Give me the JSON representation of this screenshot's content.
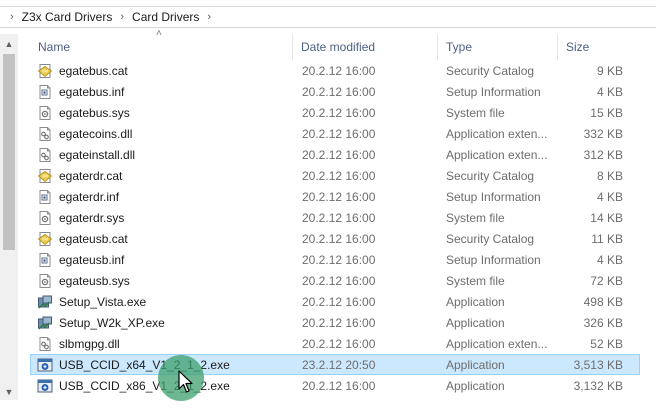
{
  "breadcrumb": {
    "items": [
      {
        "label": "Z3x Card Drivers"
      },
      {
        "label": "Card Drivers"
      }
    ]
  },
  "header": {
    "name": "Name",
    "date": "Date modified",
    "type": "Type",
    "size": "Size"
  },
  "files": [
    {
      "name": "egatebus.cat",
      "date": "20.2.12 16:00",
      "type": "Security Catalog",
      "size": "9 KB",
      "icon": "catalog-icon"
    },
    {
      "name": "egatebus.inf",
      "date": "20.2.12 16:00",
      "type": "Setup Information",
      "size": "4 KB",
      "icon": "setup-info-icon"
    },
    {
      "name": "egatebus.sys",
      "date": "20.2.12 16:00",
      "type": "System file",
      "size": "15 KB",
      "icon": "system-file-icon"
    },
    {
      "name": "egatecoins.dll",
      "date": "20.2.12 16:00",
      "type": "Application exten...",
      "size": "332 KB",
      "icon": "dll-icon"
    },
    {
      "name": "egateinstall.dll",
      "date": "20.2.12 16:00",
      "type": "Application exten...",
      "size": "312 KB",
      "icon": "dll-icon"
    },
    {
      "name": "egaterdr.cat",
      "date": "20.2.12 16:00",
      "type": "Security Catalog",
      "size": "8 KB",
      "icon": "catalog-icon"
    },
    {
      "name": "egaterdr.inf",
      "date": "20.2.12 16:00",
      "type": "Setup Information",
      "size": "4 KB",
      "icon": "setup-info-icon"
    },
    {
      "name": "egaterdr.sys",
      "date": "20.2.12 16:00",
      "type": "System file",
      "size": "14 KB",
      "icon": "system-file-icon"
    },
    {
      "name": "egateusb.cat",
      "date": "20.2.12 16:00",
      "type": "Security Catalog",
      "size": "11 KB",
      "icon": "catalog-icon"
    },
    {
      "name": "egateusb.inf",
      "date": "20.2.12 16:00",
      "type": "Setup Information",
      "size": "4 KB",
      "icon": "setup-info-icon"
    },
    {
      "name": "egateusb.sys",
      "date": "20.2.12 16:00",
      "type": "System file",
      "size": "72 KB",
      "icon": "system-file-icon"
    },
    {
      "name": "Setup_Vista.exe",
      "date": "20.2.12 16:00",
      "type": "Application",
      "size": "498 KB",
      "icon": "setup-exe-icon"
    },
    {
      "name": "Setup_W2k_XP.exe",
      "date": "20.2.12 16:00",
      "type": "Application",
      "size": "326 KB",
      "icon": "setup-exe-icon"
    },
    {
      "name": "slbmgpg.dll",
      "date": "20.2.12 16:00",
      "type": "Application exten...",
      "size": "52 KB",
      "icon": "dll-icon"
    },
    {
      "name": "USB_CCID_x64_V1_2_1_2.exe",
      "date": "23.2.12 20:50",
      "type": "Application",
      "size": "3,513 KB",
      "icon": "installer-exe-icon",
      "selected": true
    },
    {
      "name": "USB_CCID_x86_V1_2_1_2.exe",
      "date": "20.2.12 16:00",
      "type": "Application",
      "size": "3,132 KB",
      "icon": "installer-exe-icon"
    }
  ],
  "colors": {
    "selection_bg": "#cce8ff",
    "selection_border": "#99d1ff",
    "header_text": "#4d6185",
    "cursor_halo": "#3ca06e"
  }
}
